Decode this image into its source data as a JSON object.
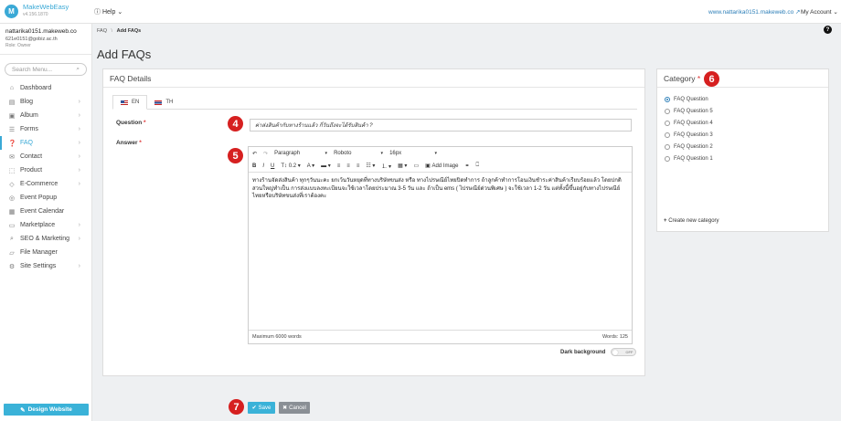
{
  "app": {
    "name": "MakeWebEasy",
    "version": "v4.156.1870",
    "logo_letter": "M"
  },
  "topbar": {
    "help": "Help",
    "site_url": "www.nattarika0151.makeweb.co",
    "my_account": "My Account"
  },
  "user": {
    "name": "nattarika0151.makeweb.co",
    "email": "621e0151@gobiz.ac.th",
    "role": "Role: Owner"
  },
  "sidebar": {
    "search_placeholder": "Search Menu...",
    "items": [
      {
        "label": "Dashboard",
        "icon": "home-icon",
        "glyph": "⌂",
        "chevron": false,
        "active": false
      },
      {
        "label": "Blog",
        "icon": "blog-icon",
        "glyph": "▤",
        "chevron": true,
        "active": false
      },
      {
        "label": "Album",
        "icon": "album-icon",
        "glyph": "▣",
        "chevron": true,
        "active": false
      },
      {
        "label": "Forms",
        "icon": "forms-icon",
        "glyph": "☰",
        "chevron": true,
        "active": false
      },
      {
        "label": "FAQ",
        "icon": "faq-icon",
        "glyph": "❓",
        "chevron": true,
        "active": true
      },
      {
        "label": "Contact",
        "icon": "contact-icon",
        "glyph": "✉",
        "chevron": true,
        "active": false
      },
      {
        "label": "Product",
        "icon": "product-icon",
        "glyph": "⬚",
        "chevron": true,
        "active": false
      },
      {
        "label": "E-Commerce",
        "icon": "ecommerce-icon",
        "glyph": "◇",
        "chevron": true,
        "active": false
      },
      {
        "label": "Event Popup",
        "icon": "event-popup-icon",
        "glyph": "◎",
        "chevron": false,
        "active": false
      },
      {
        "label": "Event Calendar",
        "icon": "calendar-icon",
        "glyph": "▦",
        "chevron": false,
        "active": false
      },
      {
        "label": "Marketplace",
        "icon": "marketplace-icon",
        "glyph": "▭",
        "chevron": true,
        "active": false
      },
      {
        "label": "SEO & Marketing",
        "icon": "seo-icon",
        "glyph": "⌕",
        "chevron": true,
        "active": false
      },
      {
        "label": "File Manager",
        "icon": "folder-icon",
        "glyph": "▱",
        "chevron": false,
        "active": false
      },
      {
        "label": "Site Settings",
        "icon": "settings-icon",
        "glyph": "⚙",
        "chevron": true,
        "active": false
      }
    ],
    "design_button": "Design Website"
  },
  "breadcrumb": {
    "parent": "FAQ",
    "separator": "\\",
    "current": "Add FAQs"
  },
  "page_title": "Add FAQs",
  "faq_panel": {
    "title": "FAQ Details",
    "tabs": [
      {
        "label": "EN",
        "active": true
      },
      {
        "label": "TH",
        "active": false
      }
    ],
    "question_label": "Question",
    "question_value": "ค่าส่งสินค้ากับทางร้านแล้ว กี่วันถึงจะได้รับสินค้า ?",
    "answer_label": "Answer",
    "toolbar": {
      "paragraph": "Paragraph",
      "font": "Roboto",
      "size": "16px",
      "line_height": "0.2",
      "add_image": "Add Image"
    },
    "answer_text": "ทางร้านจัดส่งสินค้า ทุกๆวันนะคะ ยกเว้นวันหยุดที่ทางบริษัทขนส่ง หรือ ทางไปรษณีย์ไทยปิดทำการ ถ้าลูกค้าทำการโอนเงินชำระค่าสินค้าเรียบร้อยแล้ว โดยปกติสวนใหญ่ทำเป็น การส่งแบบลงทะเบียนจะใช้เวลาโดยประมาณ 3-5 วัน และ ถ้าเป็น ems ( ไปรษณีย์ด่วนพิเศษ ) จะใช้เวลา 1-2 วัน แต่ทั้งนี้ขึ้นอยู่กับทางไปรษณีย์ไทยหรือบริษัทขนส่งที่เราต้องคะ",
    "max_words": "Maximum 6000 words",
    "word_count": "Words: 125",
    "dark_background_label": "Dark background",
    "toggle_state": "OFF"
  },
  "category_panel": {
    "title": "Category",
    "options": [
      {
        "label": "FAQ Question",
        "checked": true
      },
      {
        "label": "FAQ Question 5",
        "checked": false
      },
      {
        "label": "FAQ Question 4",
        "checked": false
      },
      {
        "label": "FAQ Question 3",
        "checked": false
      },
      {
        "label": "FAQ Question 2",
        "checked": false
      },
      {
        "label": "FAQ Question 1",
        "checked": false
      }
    ],
    "create_label": "Create new category"
  },
  "actions": {
    "save": "Save",
    "cancel": "Cancel"
  },
  "annotations": {
    "question": "4",
    "answer": "5",
    "category": "6",
    "save": "7"
  },
  "colors": {
    "accent": "#3ab2d8",
    "badge": "#d62020",
    "link": "#2d7fb8",
    "cancel": "#8a8f95"
  }
}
